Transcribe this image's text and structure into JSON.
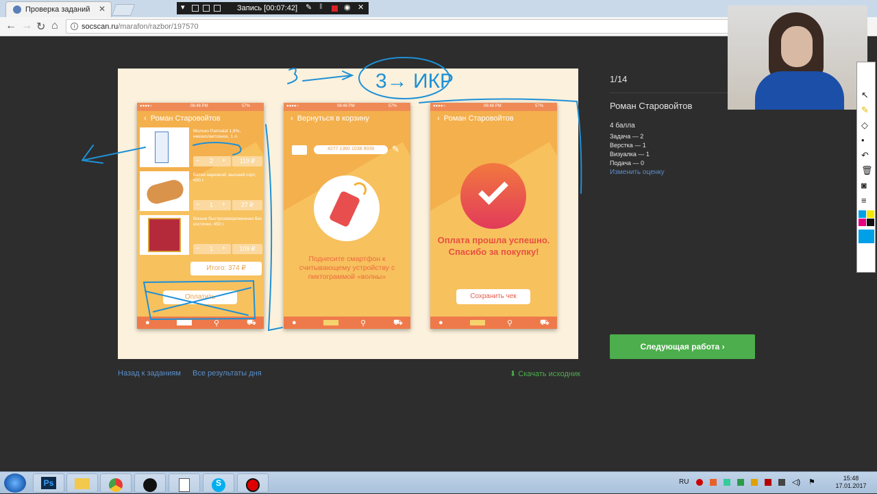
{
  "browser": {
    "tab_title": "Проверка заданий",
    "url_host": "socscan.ru",
    "url_path": "/marafon/razbor/197570",
    "rec_label": "Запись [00:07:42]"
  },
  "phone1": {
    "time": "06:46 PM",
    "battery": "57%",
    "header": "Роман Старовойтов",
    "items": [
      {
        "desc": "Молоко Parmalat 1,8%, ниизколактозное, 1 л.",
        "qty": "2",
        "price": "119 ₽"
      },
      {
        "desc": "Батон нарезной, высший сорт, 400 г.",
        "qty": "1",
        "price": "27 ₽"
      },
      {
        "desc": "Вишня быстрозамороженная без косточки, 450 г.",
        "qty": "1",
        "price": "109 ₽"
      }
    ],
    "total": "Итого: 374 ₽",
    "pay": "Оплатить"
  },
  "phone2": {
    "time": "06:46 PM",
    "battery": "57%",
    "header": "Вернуться в корзину",
    "card_number": "4277 1360 1038 9039",
    "message": "Поднесите смартфон к считывающему устройству с пиктограммой «волны»"
  },
  "phone3": {
    "time": "06:46 PM",
    "battery": "57%",
    "header": "Роман Старовойтов",
    "message": "Оплата прошла успешно. Спасибо за покупку!",
    "save": "Сохранить чек"
  },
  "links": {
    "back": "Назад к заданиям",
    "all_results": "Все результаты дня",
    "download": "Скачать исходник"
  },
  "side": {
    "counter": "1/14",
    "author": "Роман Старовойтов",
    "score": "4 балла",
    "task": "Задача — 2",
    "layout": "Верстка — 1",
    "visual": "Визуалка — 1",
    "delivery": "Подача — 0",
    "change": "Изменить оценку",
    "next": "Следующая работа"
  },
  "annotation": {
    "text": "3→ ИКР"
  },
  "taskbar": {
    "lang": "RU",
    "time": "15:48",
    "date": "17.01.2017",
    "ps_label": "Ps"
  },
  "colors": {
    "accent_green": "#4cae4c",
    "link_blue": "#5b8fca",
    "phone_orange": "#f4b04d",
    "tabbar_coral": "#ee7a4b",
    "annotation_blue": "#1e90d6"
  }
}
